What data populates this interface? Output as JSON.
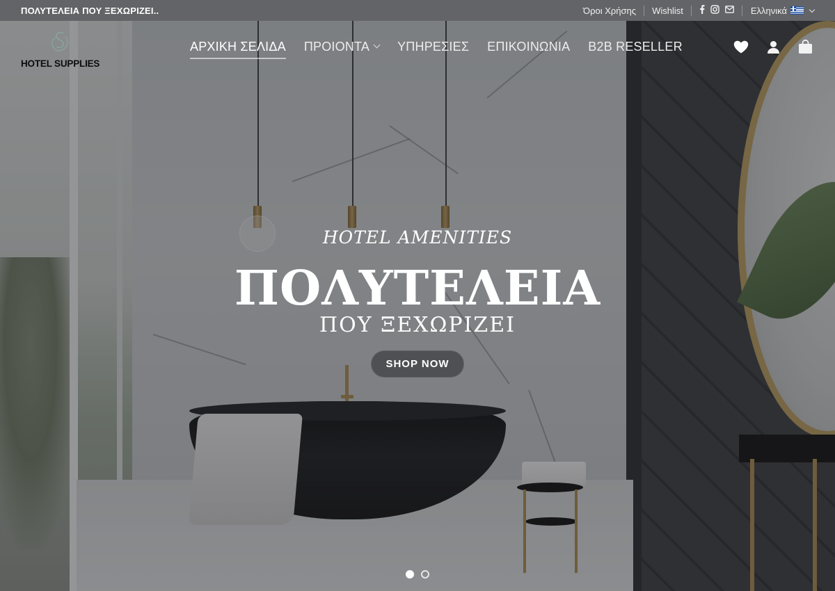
{
  "topbar": {
    "tagline": "ΠΟΛΥΤΕΛΕΙΑ ΠΟΥ ΞΕΧΩΡΙΖΕΙ..",
    "terms_link": "Όροι Χρήσης",
    "wishlist_link": "Wishlist",
    "social_icons": [
      "facebook-icon",
      "instagram-icon",
      "email-icon"
    ],
    "language": {
      "label": "Ελληνικά",
      "flag": "greek-flag-icon"
    }
  },
  "header": {
    "logo_text": "HOTEL SUPPLIES",
    "nav": [
      {
        "label": "ΑΡΧΙΚΗ ΣΕΛΙΔΑ",
        "active": true
      },
      {
        "label": "ΠΡΟΙΟΝΤΑ",
        "has_dropdown": true
      },
      {
        "label": "ΥΠΗΡΕΣΙΕΣ"
      },
      {
        "label": "ΕΠΙΚΟΙΝΩΝΙΑ"
      },
      {
        "label": "B2B RESELLER"
      }
    ],
    "icons": [
      "heart-icon",
      "user-icon",
      "shopping-bag-icon"
    ]
  },
  "hero": {
    "kicker": "HOTEL AMENITIES",
    "headline": "ΠΟΛΥΤΕΛΕΙΑ",
    "subline": "ΠΟΥ ΞΕΧΩΡΙΖΕΙ",
    "cta_label": "SHOP NOW",
    "slides_total": 2,
    "slide_active": 1
  },
  "colors": {
    "topbar_bg": "#5f6265",
    "text_light": "#ffffff",
    "cta_bg": "#46484b",
    "logo_text": "#0d0d0d"
  }
}
